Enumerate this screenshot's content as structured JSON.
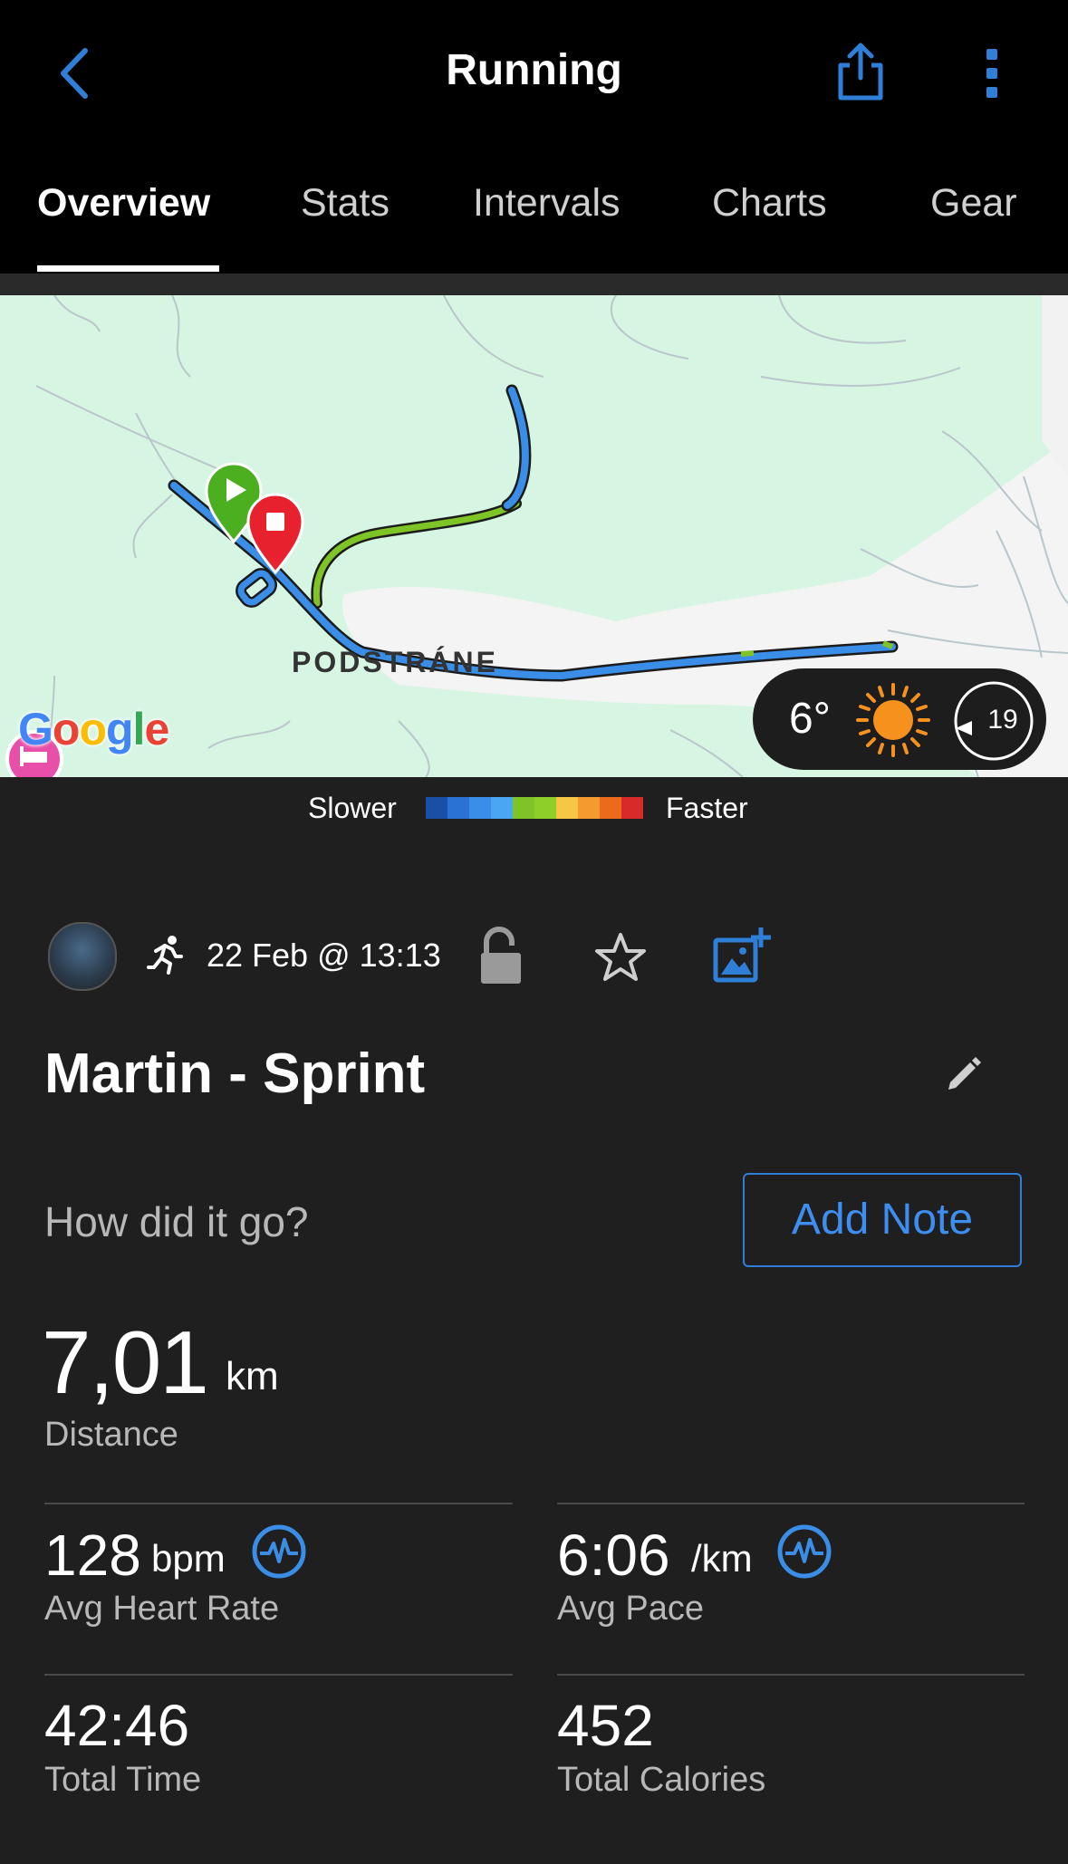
{
  "header": {
    "title": "Running",
    "back_icon": "chevron-left-icon",
    "share_icon": "share-icon",
    "more_icon": "more-vertical-icon",
    "accent_color": "#2f7fd8"
  },
  "tabs": [
    {
      "label": "Overview",
      "active": true
    },
    {
      "label": "Stats",
      "active": false
    },
    {
      "label": "Intervals",
      "active": false
    },
    {
      "label": "Charts",
      "active": false
    },
    {
      "label": "Gear",
      "active": false
    }
  ],
  "map": {
    "place_label": "PODSTRÁNE",
    "provider": "Google",
    "weather": {
      "temperature": "6°",
      "wind_speed": "19",
      "icon": "sun-icon"
    }
  },
  "legend": {
    "slower_label": "Slower",
    "faster_label": "Faster",
    "colors": [
      "#1a4fa8",
      "#2a73d4",
      "#3b8ee8",
      "#4aa6f2",
      "#7ec426",
      "#8fcf2a",
      "#f6c744",
      "#f59a2f",
      "#ec6a1c",
      "#d92a2a"
    ]
  },
  "activity": {
    "avatar": "avatar",
    "type_icon": "running-icon",
    "date": "22 Feb @ 13:13",
    "privacy_icon": "unlock-icon",
    "favorite_icon": "star-icon",
    "photo_icon": "add-photo-icon",
    "name": "Martin - Sprint",
    "edit_icon": "pencil-icon",
    "prompt": "How did it go?",
    "add_note_label": "Add Note"
  },
  "stats": {
    "distance": {
      "value": "7,01",
      "unit": "km",
      "label": "Distance"
    },
    "avg_heart_rate": {
      "value": "128",
      "unit": "bpm",
      "label": "Avg Heart Rate"
    },
    "avg_pace": {
      "value": "6:06",
      "unit": "/km",
      "label": "Avg Pace"
    },
    "total_time": {
      "value": "42:46",
      "label": "Total Time"
    },
    "total_calories": {
      "value": "452",
      "label": "Total Calories"
    }
  }
}
